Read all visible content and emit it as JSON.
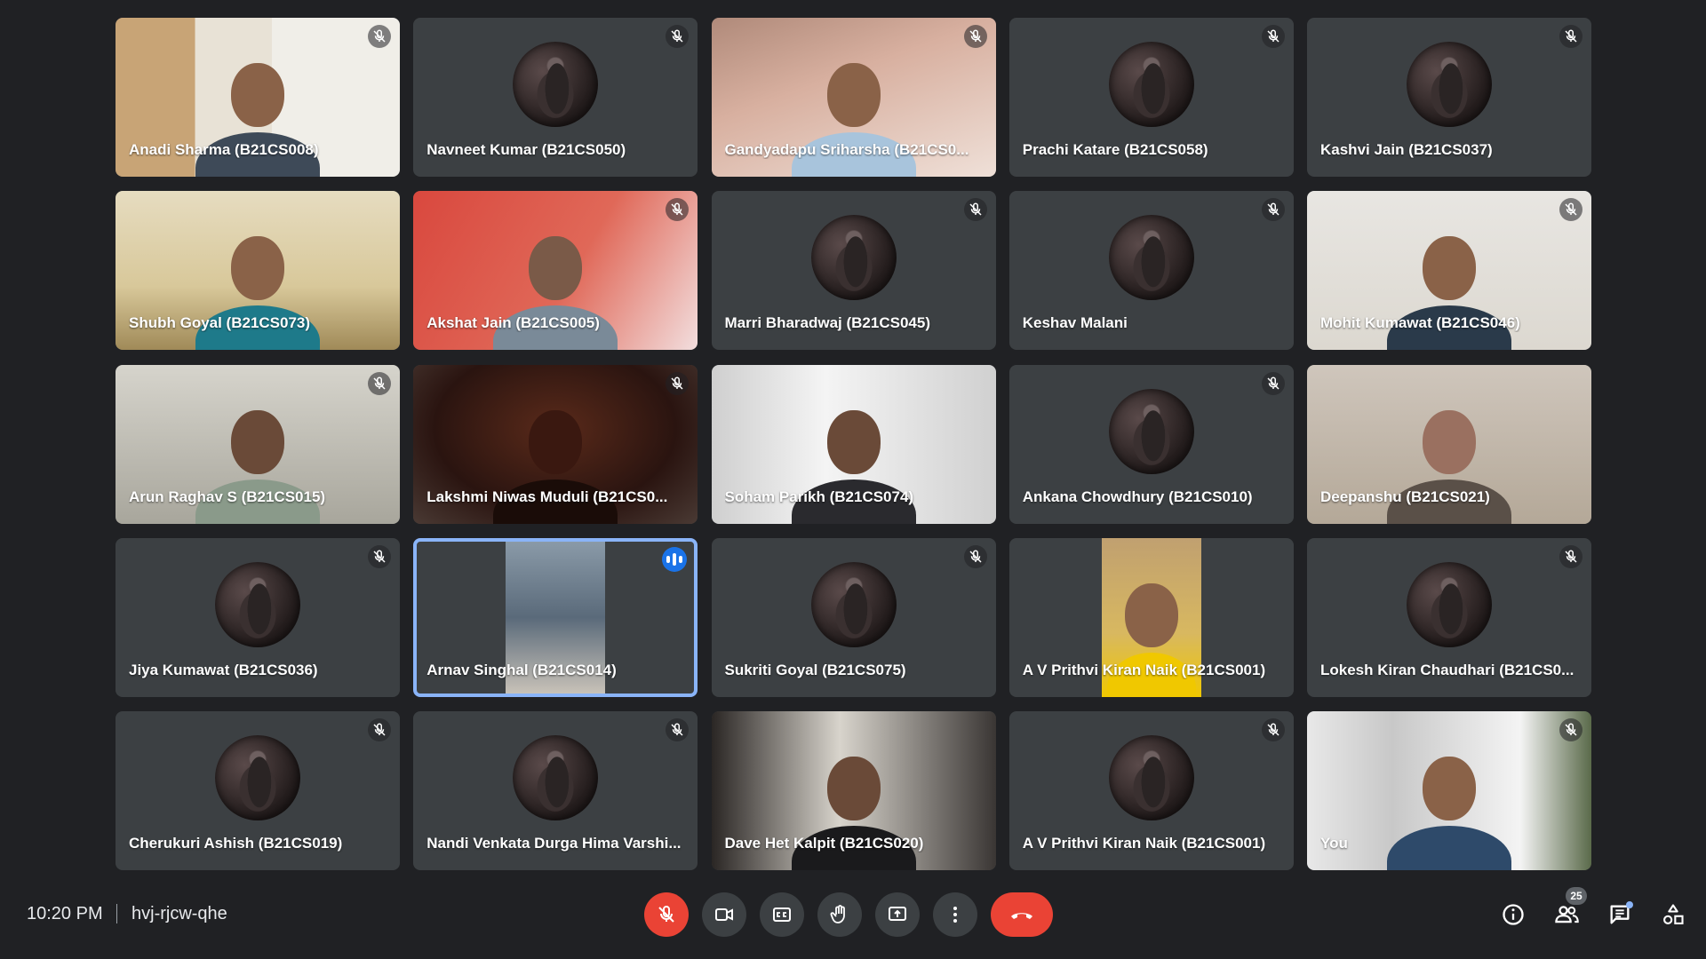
{
  "participants": [
    {
      "name": "Anadi Sharma (B21CS008)",
      "muted": true
    },
    {
      "name": "Navneet Kumar (B21CS050)",
      "muted": true
    },
    {
      "name": "Gandyadapu Sriharsha (B21CS0...",
      "muted": true
    },
    {
      "name": "Prachi Katare (B21CS058)",
      "muted": true
    },
    {
      "name": "Kashvi Jain (B21CS037)",
      "muted": true
    },
    {
      "name": "Shubh Goyal (B21CS073)",
      "muted": false
    },
    {
      "name": "Akshat Jain (B21CS005)",
      "muted": true
    },
    {
      "name": "Marri Bharadwaj (B21CS045)",
      "muted": true
    },
    {
      "name": "Keshav Malani",
      "muted": true
    },
    {
      "name": "Mohit Kumawat (B21CS046)",
      "muted": true
    },
    {
      "name": "Arun Raghav S (B21CS015)",
      "muted": true
    },
    {
      "name": "Lakshmi Niwas Muduli (B21CS0...",
      "muted": true
    },
    {
      "name": "Soham Parikh (B21CS074)",
      "muted": false
    },
    {
      "name": "Ankana Chowdhury (B21CS010)",
      "muted": true
    },
    {
      "name": "Deepanshu (B21CS021)",
      "muted": false
    },
    {
      "name": "Jiya Kumawat (B21CS036)",
      "muted": true
    },
    {
      "name": "Arnav Singhal (B21CS014)",
      "muted": false,
      "speaking": true
    },
    {
      "name": "Sukriti Goyal (B21CS075)",
      "muted": true
    },
    {
      "name": "A V Prithvi Kiran Naik (B21CS001)",
      "muted": false
    },
    {
      "name": "Lokesh Kiran Chaudhari (B21CS0...",
      "muted": true
    },
    {
      "name": "Cherukuri Ashish (B21CS019)",
      "muted": true
    },
    {
      "name": "Nandi Venkata Durga Hima Varshi...",
      "muted": true
    },
    {
      "name": "Dave Het Kalpit (B21CS020)",
      "muted": false
    },
    {
      "name": "A V Prithvi Kiran Naik (B21CS001)",
      "muted": true
    },
    {
      "name": "You",
      "muted": true
    }
  ],
  "meeting": {
    "time": "10:20 PM",
    "code": "hvj-rjcw-qhe"
  },
  "people_count": "25",
  "colors": {
    "background": "#202124",
    "tile": "#3c4043",
    "danger": "#ea4335",
    "speaking_border": "#8ab4f8",
    "speaking_badge": "#1a73e8"
  },
  "icons": {
    "mic_off": "mic-off-icon",
    "camera": "camera-icon",
    "captions": "closed-captions-icon",
    "hand": "raise-hand-icon",
    "present": "present-screen-icon",
    "more": "more-vert-icon",
    "end": "end-call-icon",
    "info": "info-icon",
    "people": "people-icon",
    "chat": "chat-icon",
    "activities": "activities-icon"
  }
}
